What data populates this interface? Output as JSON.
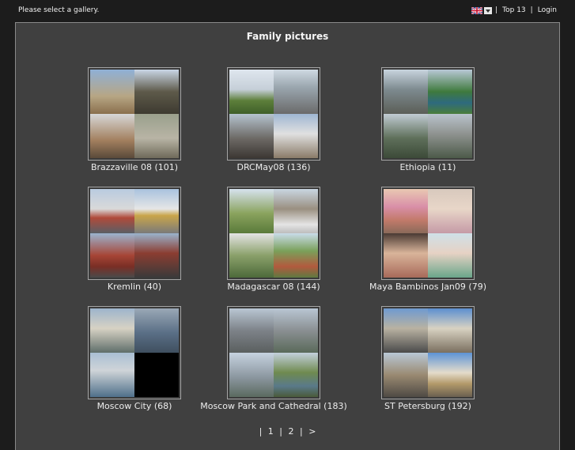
{
  "header": {
    "status": "Please select a gallery.",
    "top13": "Top 13",
    "login": "Login",
    "sep": "|"
  },
  "gallery": {
    "title": "Family pictures",
    "albums": [
      {
        "caption": "Brazzaville 08 (101)"
      },
      {
        "caption": "DRCMay08 (136)"
      },
      {
        "caption": "Ethiopia (11)"
      },
      {
        "caption": "Kremlin (40)"
      },
      {
        "caption": "Madagascar 08 (144)"
      },
      {
        "caption": "Maya Bambinos Jan09 (79)"
      },
      {
        "caption": "Moscow City (68)"
      },
      {
        "caption": "Moscow Park and Cathedral (183)"
      },
      {
        "caption": "ST Petersburg (192)"
      }
    ]
  },
  "pager": {
    "p1": "1",
    "p2": "2",
    "next": ">",
    "sep": "|"
  }
}
